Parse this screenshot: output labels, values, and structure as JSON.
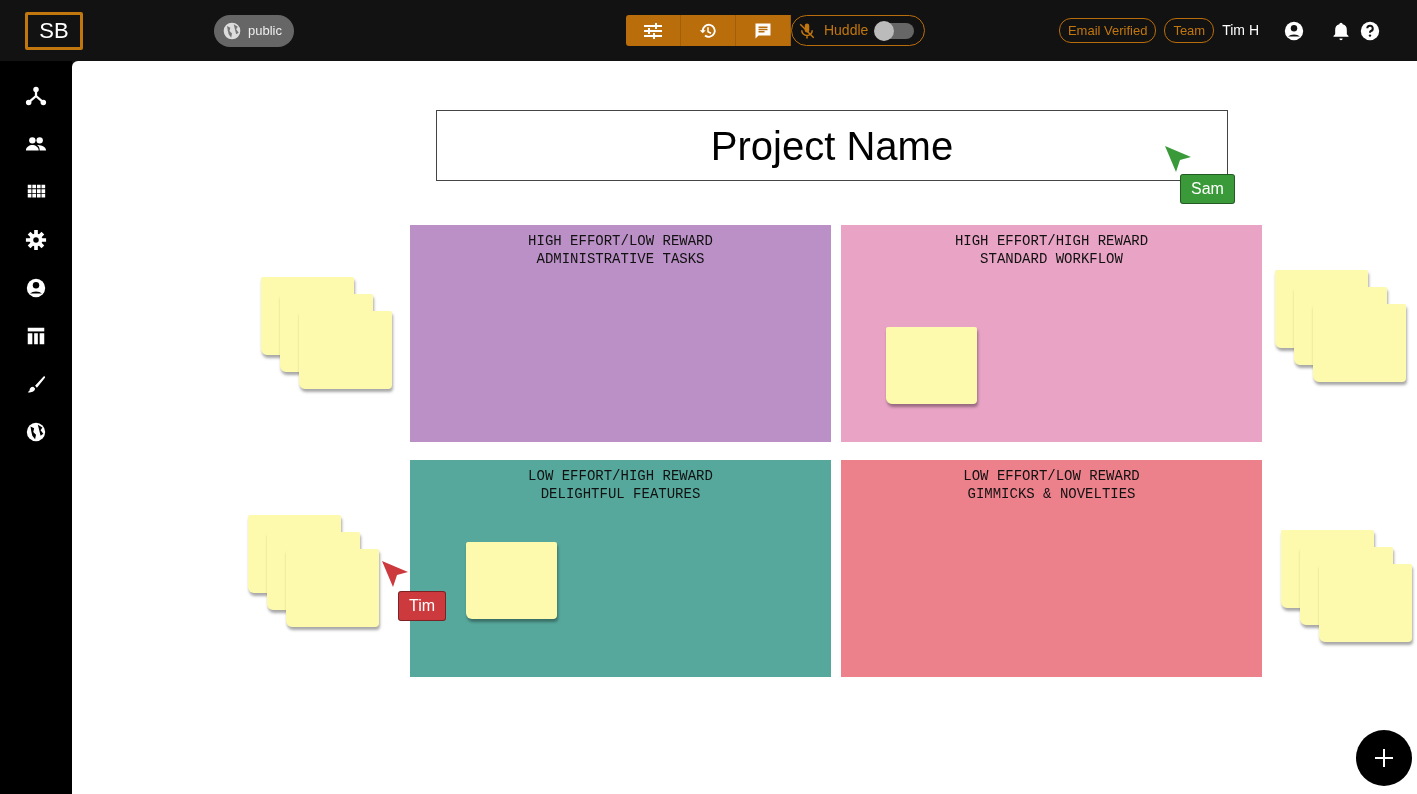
{
  "topbar": {
    "logo": "SB",
    "visibility": "public",
    "huddle": {
      "label": "Huddle",
      "on": false
    },
    "badges": [
      "Email Verified",
      "Team"
    ],
    "user": "Tim H"
  },
  "board": {
    "title": "Project Name",
    "quadrants": [
      {
        "title": "HIGH EFFORT/LOW REWARD",
        "subtitle": "ADMINISTRATIVE TASKS",
        "color": "#bb90c6"
      },
      {
        "title": "HIGH EFFORT/HIGH REWARD",
        "subtitle": "STANDARD WORKFLOW",
        "color": "#e8a3c5"
      },
      {
        "title": "LOW EFFORT/HIGH REWARD",
        "subtitle": "DELIGHTFUL FEATURES",
        "color": "#57a89c"
      },
      {
        "title": "LOW EFFORT/LOW REWARD",
        "subtitle": "GIMMICKS & NOVELTIES",
        "color": "#ec808b"
      }
    ],
    "cursors": [
      {
        "name": "Sam",
        "color": "#3a9a3a"
      },
      {
        "name": "Tim",
        "color": "#cc3a3d"
      }
    ]
  }
}
